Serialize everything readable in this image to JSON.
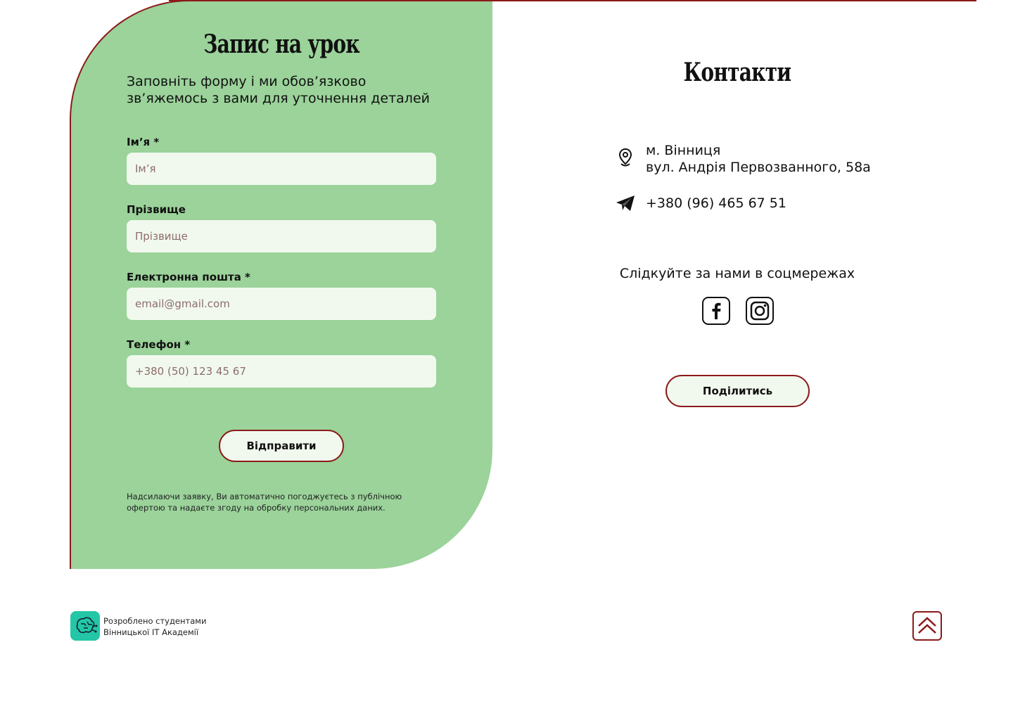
{
  "colors": {
    "panel_green": "#9bd39a",
    "input_bg": "#f1f9ee",
    "accent_red": "#8b1a1a",
    "logo_teal": "#23c6a6"
  },
  "form": {
    "title": "Запис на урок",
    "subtitle": "Заповніть форму і ми обов’язково зв’яжемось з вами для уточнення деталей",
    "fields": [
      {
        "label": "Ім’я *",
        "placeholder": "Ім’я",
        "value": ""
      },
      {
        "label": "Прізвище",
        "placeholder": "Прізвище",
        "value": ""
      },
      {
        "label": "Електронна пошта *",
        "placeholder": "email@gmail.com",
        "value": ""
      },
      {
        "label": "Телефон *",
        "placeholder": "+380 (50) 123 45 67",
        "value": ""
      }
    ],
    "submit_label": "Відправити",
    "disclaimer": "Надсилаючи заявку, Ви автоматично погоджуєтесь з публічною офертою та надаєте згоду на обробку персональних даних."
  },
  "contacts": {
    "title": "Контакти",
    "address_line1": "м. Вінниця",
    "address_line2": "вул. Андрія Первозванного, 58а",
    "address_icon": "location-pin-icon",
    "phone": "+380 (96) 465 67 51",
    "phone_icon": "telegram-icon",
    "social_title": "Слідкуйте за нами в соцмережах",
    "social_icons": [
      "facebook-icon",
      "instagram-icon"
    ],
    "share_label": "Поділитись"
  },
  "footer": {
    "credit_line1": "Розроблено студентами",
    "credit_line2": "Вінницької ІТ Академії",
    "logo_icon": "brain-circuit-icon",
    "scroll_top_icon": "double-chevron-up-icon"
  }
}
